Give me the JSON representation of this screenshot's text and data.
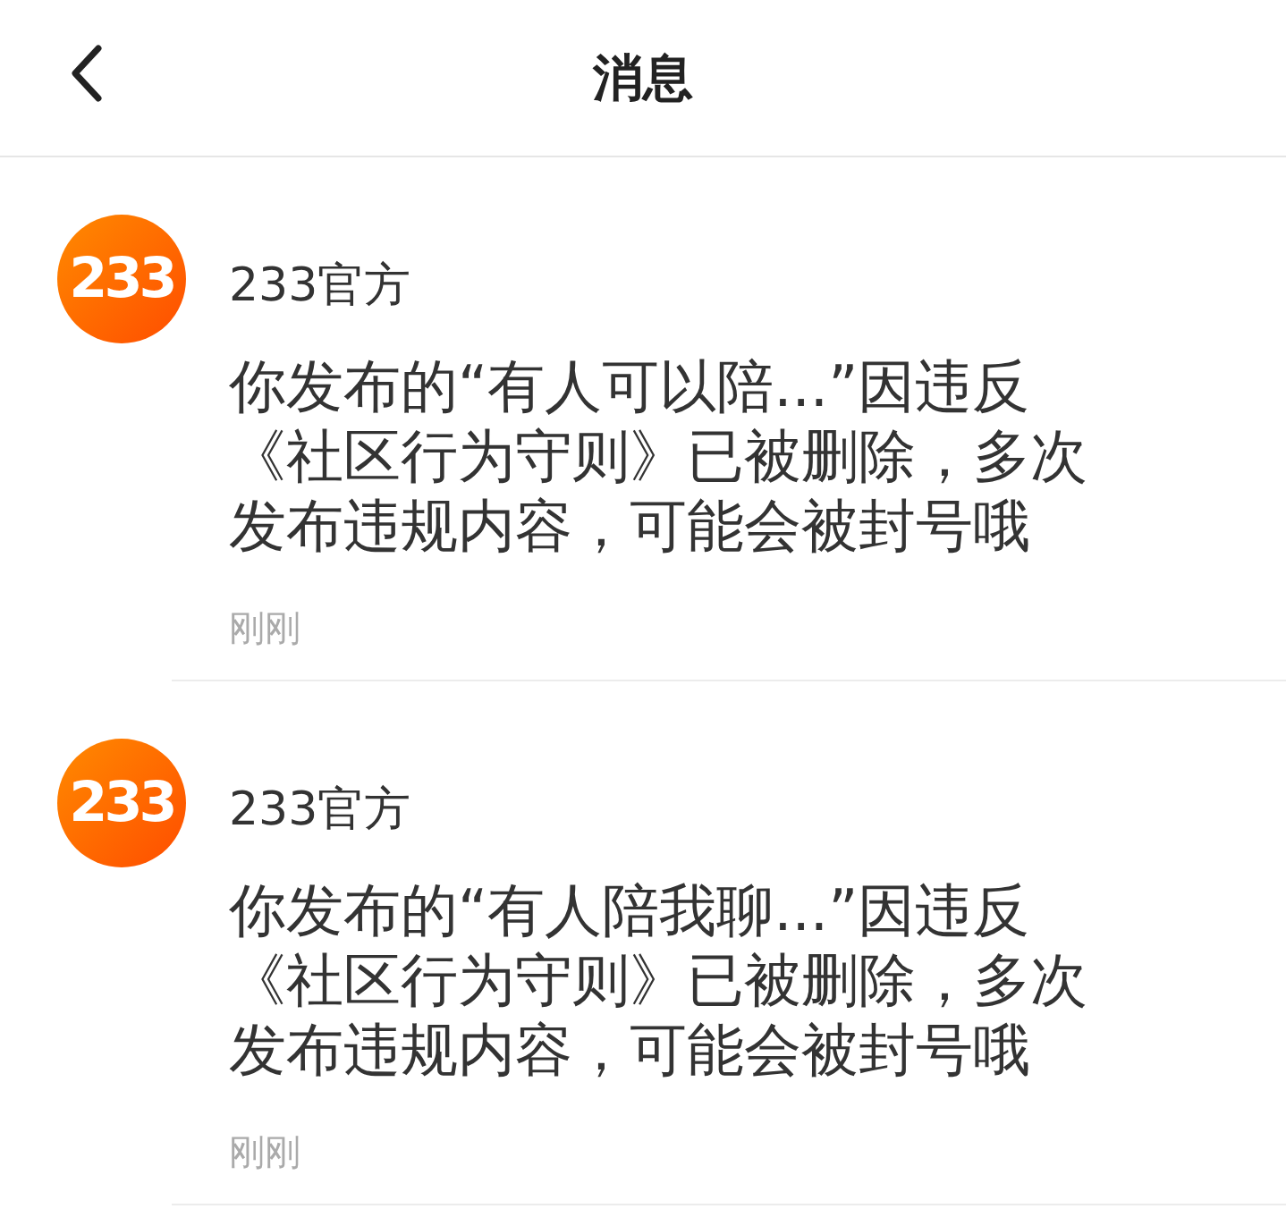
{
  "header": {
    "title": "消息"
  },
  "messages": [
    {
      "avatar": "233",
      "sender": "233官方",
      "body": "你发布的“有人可以陪...”因违反《社区行为守则》已被删除，多次发布违规内容，可能会被封号哦",
      "time": "刚刚"
    },
    {
      "avatar": "233",
      "sender": "233官方",
      "body": "你发布的“有人陪我聊...”因违反《社区行为守则》已被删除，多次发布违规内容，可能会被封号哦",
      "time": "刚刚"
    }
  ]
}
